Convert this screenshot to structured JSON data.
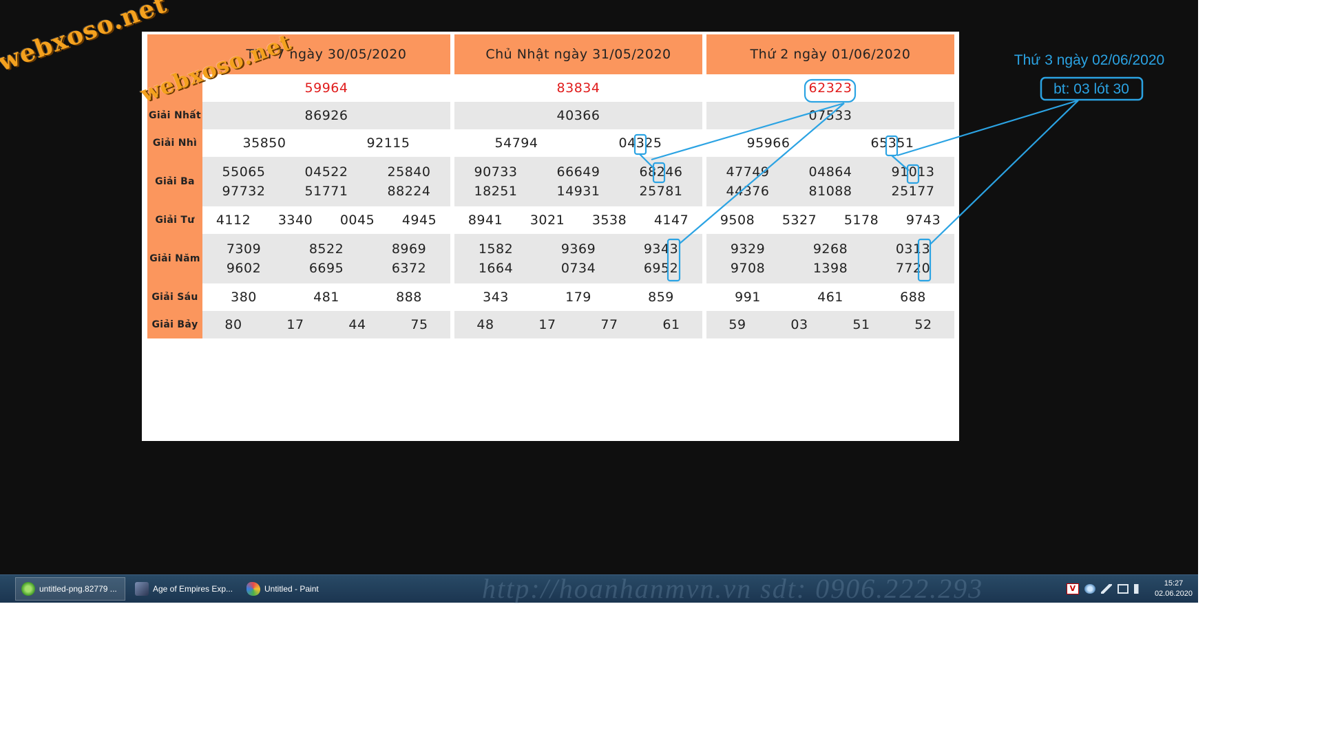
{
  "watermark": "webxoso.net",
  "columns": [
    {
      "header": "Thứ 7 ngày 30/05/2020",
      "special": "59964",
      "nhat": "86926",
      "nhi": [
        "35850",
        "92115"
      ],
      "ba": [
        [
          "55065",
          "04522",
          "25840"
        ],
        [
          "97732",
          "51771",
          "88224"
        ]
      ],
      "tu": [
        "4112",
        "3340",
        "0045",
        "4945"
      ],
      "nam": [
        [
          "7309",
          "8522",
          "8969"
        ],
        [
          "9602",
          "6695",
          "6372"
        ]
      ],
      "sau": [
        "380",
        "481",
        "888"
      ],
      "bay": [
        "80",
        "17",
        "44",
        "75"
      ]
    },
    {
      "header": "Chủ Nhật ngày 31/05/2020",
      "special": "83834",
      "nhat": "40366",
      "nhi": [
        "54794",
        "04325"
      ],
      "ba": [
        [
          "90733",
          "66649",
          "68246"
        ],
        [
          "18251",
          "14931",
          "25781"
        ]
      ],
      "tu": [
        "8941",
        "3021",
        "3538",
        "4147"
      ],
      "nam": [
        [
          "1582",
          "9369",
          "9343"
        ],
        [
          "1664",
          "0734",
          "6952"
        ]
      ],
      "sau": [
        "343",
        "179",
        "859"
      ],
      "bay": [
        "48",
        "17",
        "77",
        "61"
      ]
    },
    {
      "header": "Thứ 2 ngày 01/06/2020",
      "special": "62323",
      "nhat": "07533",
      "nhi": [
        "95966",
        "65351"
      ],
      "ba": [
        [
          "47749",
          "04864",
          "91013"
        ],
        [
          "44376",
          "81088",
          "25177"
        ]
      ],
      "tu": [
        "9508",
        "5327",
        "5178",
        "9743"
      ],
      "nam": [
        [
          "9329",
          "9268",
          "0313"
        ],
        [
          "9708",
          "1398",
          "7720"
        ]
      ],
      "sau": [
        "991",
        "461",
        "688"
      ],
      "bay": [
        "59",
        "03",
        "51",
        "52"
      ]
    }
  ],
  "labels": {
    "nhat": "Giải Nhất",
    "nhi": "Giải Nhì",
    "ba": "Giải Ba",
    "tu": "Giải Tư",
    "nam": "Giải Năm",
    "sau": "Giải Sáu",
    "bay": "Giải Bảy"
  },
  "annotation": {
    "title": "Thứ 3 ngày 02/06/2020",
    "box_text": "bt: 03 lót 30",
    "color": "#2ba3e3"
  },
  "taskbar": {
    "items": [
      {
        "label": "untitled-png.82779 ...",
        "icon": "greenshot-icon"
      },
      {
        "label": "Age of Empires Exp...",
        "icon": "aoe-icon"
      },
      {
        "label": "Untitled - Paint",
        "icon": "paint-icon"
      }
    ],
    "background_text": "http://hoanhanmvn.vn   sdt: 0906.222.293",
    "clock_time": "15:27",
    "clock_date": "02.06.2020"
  },
  "colors": {
    "header_bg": "#fb965d",
    "special_text": "#e01c1c",
    "zebra": "#e7e7e7",
    "desktop": "#0f0f0f"
  }
}
